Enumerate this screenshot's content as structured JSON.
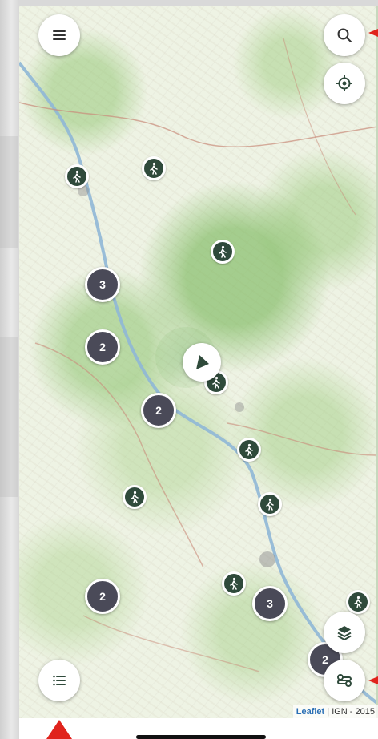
{
  "colors": {
    "marker_hike": "#2f4a3b",
    "marker_cluster": "#4a4a58",
    "accent_arrow": "#e0231c",
    "control_icon": "#2f4a3b"
  },
  "controls": {
    "menu": {
      "icon": "menu-icon"
    },
    "search": {
      "icon": "search-icon"
    },
    "locate": {
      "icon": "crosshair-icon"
    },
    "layers": {
      "icon": "layers-icon"
    },
    "route": {
      "icon": "route-icon"
    },
    "list": {
      "icon": "list-icon"
    }
  },
  "clusters": [
    {
      "count": "3"
    },
    {
      "count": "2"
    },
    {
      "count": "2"
    },
    {
      "count": "2"
    },
    {
      "count": "3"
    },
    {
      "count": "2"
    }
  ],
  "hike_marker_icon": "hiker-icon",
  "attribution": {
    "leaflet": "Leaflet",
    "separator": " | ",
    "source": "IGN - 2015"
  }
}
